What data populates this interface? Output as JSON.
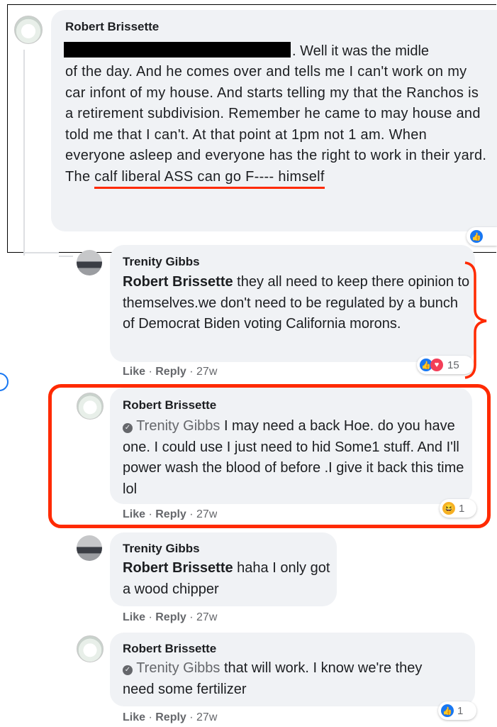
{
  "comments": [
    {
      "author": "Robert Brissette",
      "text_line1": ". Well it was the midle",
      "text_rest": "of the day. And he comes over and tells me I can't work on my car infont of my house. And starts telling my that the Ranchos is a retirement subdivision. Remember he came to may house and told me that I can't. At that point at 1pm not 1 am. When everyone asleep and everyone has the right to work in their yard. The",
      "text_underlined": "calf liberal ASS can go F---- himself"
    },
    {
      "author": "Trenity Gibbs",
      "tag": "Robert Brissette",
      "text": " they all need to keep there opinion to themselves.we don't need to be regulated by a bunch of Democrat Biden voting California morons.",
      "like": "Like",
      "reply": "Reply",
      "time": "27w",
      "reaction_count": "15"
    },
    {
      "author": "Robert Brissette",
      "mention": "Trenity Gibbs",
      "text": " I may need a back Hoe. do you have one. I could use I just need to hid Some1 stuff. And I'll power wash the blood of before .I give it back this time lol",
      "like": "Like",
      "reply": "Reply",
      "time": "27w",
      "reaction_count": "1"
    },
    {
      "author": "Trenity Gibbs",
      "tag": "Robert Brissette",
      "text": " haha I only got a wood chipper",
      "like": "Like",
      "reply": "Reply",
      "time": "27w"
    },
    {
      "author": "Robert Brissette",
      "mention": "Trenity Gibbs",
      "text": " that will work. I know we're they need some fertilizer",
      "like": "Like",
      "reply": "Reply",
      "time": "27w",
      "reaction_count": "1"
    }
  ],
  "separator": " · ",
  "colors": {
    "bubble": "#f0f2f5",
    "annotation_red": "#ff2a00",
    "like_blue": "#1877f2",
    "love_red": "#f33e58"
  },
  "icons": [
    "like-icon",
    "love-icon",
    "haha-icon",
    "at-sign-icon"
  ]
}
